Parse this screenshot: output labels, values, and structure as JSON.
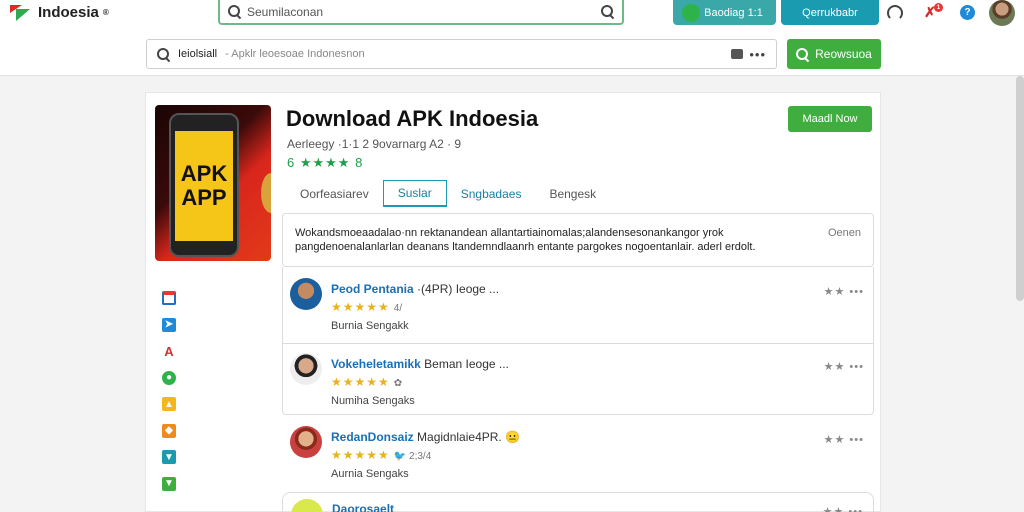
{
  "header": {
    "logo_text": "Indoesia",
    "logo_mark": "®",
    "search_placeholder": "Seumilaconan",
    "btn_left": "Baodiag 1:1",
    "btn_right": "Qerrukbabr",
    "notif_count": "1"
  },
  "subbar": {
    "query": "Ieiolsiall",
    "hint": "- Apklr leoesoae  Indonesnon",
    "dots": "•••",
    "search_btn": "Reowsuoa"
  },
  "app": {
    "icon_text_1": "APK",
    "icon_text_2": "APP",
    "title": "Download APK Indoesia",
    "meta": "Aerleegy ·1·1 2 9ovarnarg  A2 · 9",
    "rating": "6 ★★★★ 8",
    "install_btn": "Maadl Now"
  },
  "tabs": [
    "Oorfeasiarev",
    "Suslar",
    "Sngbadaes",
    "Bengesk"
  ],
  "description": {
    "line1": "Wokandsmoeaadalao·nn rektanandean allantartiainomalas;alandensesonankangor yrok",
    "line2": "pangdenoenalanlarlan  deanans ltandemndlaanrh entante pargokes nogoentanlair. aderl erdolt.",
    "more": "Oenen"
  },
  "reviews": [
    {
      "name": "Peod  Pentania",
      "extra": "·(4PR)  Ieoge ...",
      "stars": "★★★★★",
      "note": "4/",
      "sub": "Burnia Sengakk",
      "more": "★★ •••"
    },
    {
      "name": "Vokeheletamikk",
      "extra": "Beman Ieoge ...",
      "stars": "★★★★★",
      "note": "✿",
      "sub": "Numiha Sengaks",
      "more": "★★ •••"
    },
    {
      "name": "RedanDonsaiz",
      "extra": "Magidnlaie4PR. 😐",
      "stars": "★★★★★",
      "note": "🐦 2;3/4",
      "sub": "Aurnia Sengaks",
      "more": "★★ •••"
    },
    {
      "name": "Daorosaelt",
      "extra": "",
      "stars": "",
      "note": "",
      "sub": "",
      "more": "★★ •••"
    }
  ],
  "colors": {
    "brand_green": "#3fae3f",
    "teal": "#1a9bb0",
    "link_blue": "#1a6fb5",
    "star_gold": "#e8b21b"
  },
  "icons": {
    "rail": [
      "mail-icon",
      "send-icon",
      "font-icon",
      "chat-icon",
      "folder-icon",
      "image-icon",
      "tv-icon",
      "download-icon"
    ]
  }
}
